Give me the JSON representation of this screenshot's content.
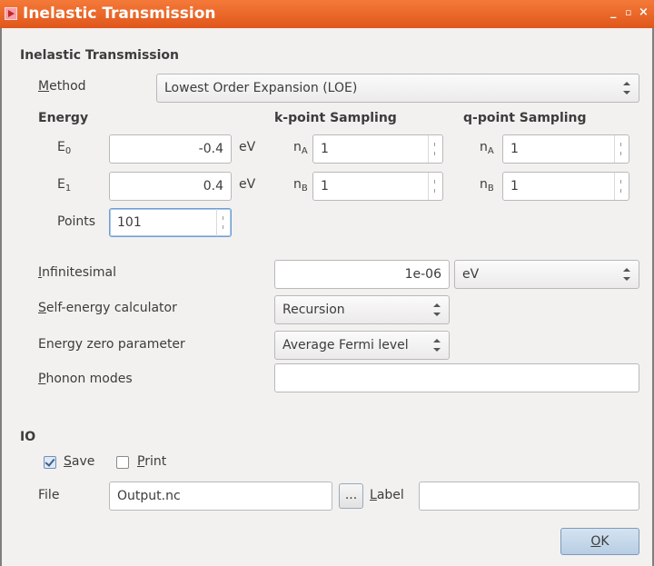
{
  "window": {
    "title": "Inelastic Transmission",
    "controls": [
      "_",
      "▫",
      "×"
    ]
  },
  "section_title": "Inelastic Transmission",
  "method": {
    "label": "Method",
    "value": "Lowest Order Expansion (LOE)"
  },
  "energy": {
    "heading": "Energy",
    "e0_label": "E",
    "e0_sub": "0",
    "e0_value": "-0.4",
    "e0_unit": "eV",
    "e1_label": "E",
    "e1_sub": "1",
    "e1_value": "0.4",
    "e1_unit": "eV",
    "points_label": "Points",
    "points_value": "101"
  },
  "kpoint": {
    "heading": "k-point Sampling",
    "na_label": "n",
    "na_sub": "A",
    "na_value": "1",
    "nb_label": "n",
    "nb_sub": "B",
    "nb_value": "1"
  },
  "qpoint": {
    "heading": "q-point Sampling",
    "na_label": "n",
    "na_sub": "A",
    "na_value": "1",
    "nb_label": "n",
    "nb_sub": "B",
    "nb_value": "1"
  },
  "infinitesimal": {
    "label": "Infinitesimal",
    "value": "1e-06",
    "unit": "eV"
  },
  "self_energy": {
    "label": "Self-energy calculator",
    "value": "Recursion"
  },
  "energy_zero": {
    "label": "Energy zero parameter",
    "value": "Average Fermi level"
  },
  "phonon_modes": {
    "label": "Phonon modes",
    "value": ""
  },
  "io": {
    "heading": "IO",
    "save_label": "Save",
    "save_checked": true,
    "print_label": "Print",
    "print_checked": false,
    "file_label": "File",
    "file_value": "Output.nc",
    "browse_label": "...",
    "label_label": "Label",
    "label_value": ""
  },
  "ok_label": "OK",
  "colors": {
    "titlebar": "#e0561b",
    "background": "#f2f1f0",
    "focus": "#6f9ed1"
  }
}
